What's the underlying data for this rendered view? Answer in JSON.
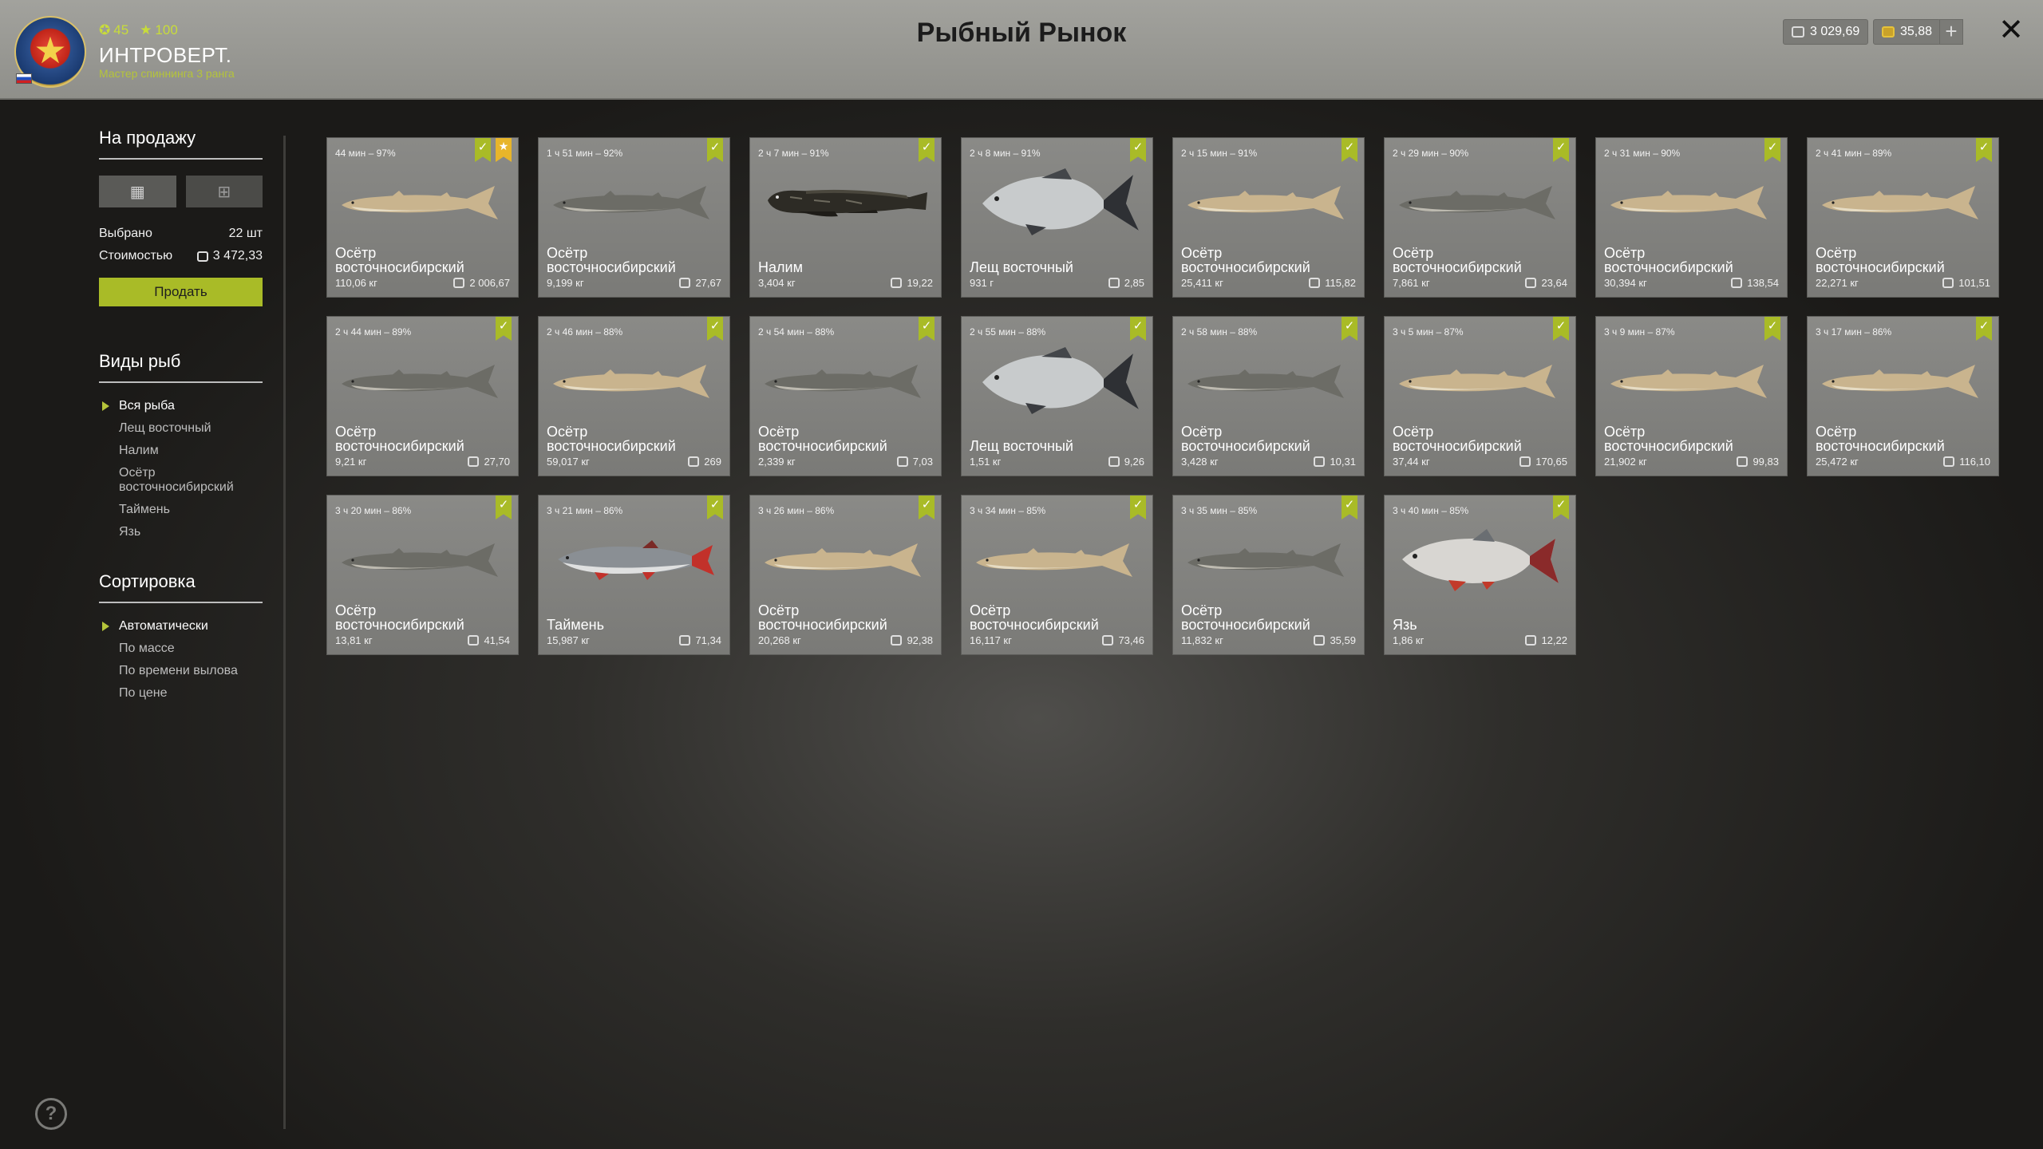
{
  "header": {
    "title": "Рыбный Рынок",
    "level": "45",
    "stars": "100",
    "player_name": "ИНТРОВЕРТ.",
    "player_title": "Мастер спиннинга 3 ранга",
    "silver": "3 029,69",
    "gold": "35,88",
    "plus": "+",
    "close": "✕"
  },
  "sidebar": {
    "for_sale_heading": "На продажу",
    "selected_label": "Выбрано",
    "selected_value": "22 шт",
    "cost_label": "Стоимостью",
    "cost_value": "3 472,33",
    "sell_label": "Продать",
    "fish_types_heading": "Виды рыб",
    "fish_types": [
      "Вся рыба",
      "Лещ восточный",
      "Налим",
      "Осётр восточносибирский",
      "Таймень",
      "Язь"
    ],
    "sort_heading": "Сортировка",
    "sort_options": [
      "Автоматически",
      "По массе",
      "По времени вылова",
      "По цене"
    ]
  },
  "colors": {
    "accent": "#a9bb27",
    "header_bg": "#9a9a95",
    "card_bg": "#82827f",
    "star": "#e8b52a"
  },
  "icons": {
    "check": "checkmark-ribbon-icon",
    "star": "star-ribbon-icon",
    "coin": "silver-coin-icon",
    "help": "help-icon"
  },
  "cards": [
    {
      "time": "44 мин – 97%",
      "name": "Осётр восточносибирский",
      "weight": "110,06 кг",
      "price": "2 006,67",
      "fish": "sturgeon-light",
      "star": true
    },
    {
      "time": "1 ч 51 мин – 92%",
      "name": "Осётр восточносибирский",
      "weight": "9,199 кг",
      "price": "27,67",
      "fish": "sturgeon-dark"
    },
    {
      "time": "2 ч 7 мин – 91%",
      "name": "Налим",
      "weight": "3,404 кг",
      "price": "19,22",
      "fish": "burbot"
    },
    {
      "time": "2 ч 8 мин – 91%",
      "name": "Лещ восточный",
      "weight": "931 г",
      "price": "2,85",
      "fish": "bream"
    },
    {
      "time": "2 ч 15 мин – 91%",
      "name": "Осётр восточносибирский",
      "weight": "25,411 кг",
      "price": "115,82",
      "fish": "sturgeon-light"
    },
    {
      "time": "2 ч 29 мин – 90%",
      "name": "Осётр восточносибирский",
      "weight": "7,861 кг",
      "price": "23,64",
      "fish": "sturgeon-dark"
    },
    {
      "time": "2 ч 31 мин – 90%",
      "name": "Осётр восточносибирский",
      "weight": "30,394 кг",
      "price": "138,54",
      "fish": "sturgeon-light"
    },
    {
      "time": "2 ч 41 мин – 89%",
      "name": "Осётр восточносибирский",
      "weight": "22,271 кг",
      "price": "101,51",
      "fish": "sturgeon-light"
    },
    {
      "time": "2 ч 44 мин – 89%",
      "name": "Осётр восточносибирский",
      "weight": "9,21 кг",
      "price": "27,70",
      "fish": "sturgeon-dark"
    },
    {
      "time": "2 ч 46 мин – 88%",
      "name": "Осётр восточносибирский",
      "weight": "59,017 кг",
      "price": "269",
      "fish": "sturgeon-light"
    },
    {
      "time": "2 ч 54 мин – 88%",
      "name": "Осётр восточносибирский",
      "weight": "2,339 кг",
      "price": "7,03",
      "fish": "sturgeon-dark"
    },
    {
      "time": "2 ч 55 мин – 88%",
      "name": "Лещ восточный",
      "weight": "1,51 кг",
      "price": "9,26",
      "fish": "bream"
    },
    {
      "time": "2 ч 58 мин – 88%",
      "name": "Осётр восточносибирский",
      "weight": "3,428 кг",
      "price": "10,31",
      "fish": "sturgeon-dark"
    },
    {
      "time": "3 ч 5 мин – 87%",
      "name": "Осётр восточносибирский",
      "weight": "37,44 кг",
      "price": "170,65",
      "fish": "sturgeon-light"
    },
    {
      "time": "3 ч 9 мин – 87%",
      "name": "Осётр восточносибирский",
      "weight": "21,902 кг",
      "price": "99,83",
      "fish": "sturgeon-light"
    },
    {
      "time": "3 ч 17 мин – 86%",
      "name": "Осётр восточносибирский",
      "weight": "25,472 кг",
      "price": "116,10",
      "fish": "sturgeon-light"
    },
    {
      "time": "3 ч 20 мин – 86%",
      "name": "Осётр восточносибирский",
      "weight": "13,81 кг",
      "price": "41,54",
      "fish": "sturgeon-dark"
    },
    {
      "time": "3 ч 21 мин – 86%",
      "name": "Таймень",
      "weight": "15,987 кг",
      "price": "71,34",
      "fish": "taimen"
    },
    {
      "time": "3 ч 26 мин – 86%",
      "name": "Осётр восточносибирский",
      "weight": "20,268 кг",
      "price": "92,38",
      "fish": "sturgeon-light"
    },
    {
      "time": "3 ч 34 мин – 85%",
      "name": "Осётр восточносибирский",
      "weight": "16,117 кг",
      "price": "73,46",
      "fish": "sturgeon-light"
    },
    {
      "time": "3 ч 35 мин – 85%",
      "name": "Осётр восточносибирский",
      "weight": "11,832 кг",
      "price": "35,59",
      "fish": "sturgeon-dark"
    },
    {
      "time": "3 ч 40 мин – 85%",
      "name": "Язь",
      "weight": "1,86 кг",
      "price": "12,22",
      "fish": "ide"
    }
  ]
}
